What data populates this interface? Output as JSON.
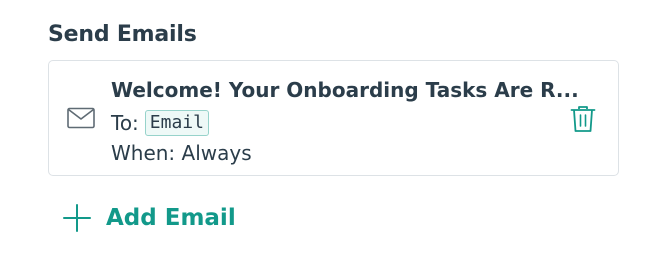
{
  "section": {
    "title": "Send Emails"
  },
  "email_card": {
    "title": "Welcome! Your Onboarding Tasks Are R...",
    "to_label": "To:",
    "to_value": "Email",
    "when_text": "When: Always",
    "icons": {
      "mail": "mail-icon",
      "delete": "trash-icon"
    }
  },
  "actions": {
    "add_email_label": "Add Email",
    "add_icon": "plus-icon"
  },
  "colors": {
    "accent": "#12998a",
    "text": "#2b3d4a",
    "border": "#dde2e6",
    "chip_bg": "#eef9f7",
    "chip_border": "#97d3cb",
    "icon_gray": "#5f6b74"
  }
}
